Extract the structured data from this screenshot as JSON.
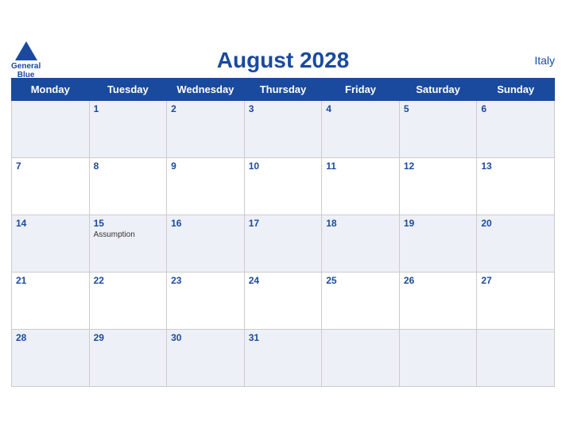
{
  "header": {
    "title": "August 2028",
    "country": "Italy",
    "logo_general": "General",
    "logo_blue": "Blue"
  },
  "weekdays": [
    "Monday",
    "Tuesday",
    "Wednesday",
    "Thursday",
    "Friday",
    "Saturday",
    "Sunday"
  ],
  "weeks": [
    [
      {
        "day": "",
        "empty": true
      },
      {
        "day": "1"
      },
      {
        "day": "2"
      },
      {
        "day": "3"
      },
      {
        "day": "4"
      },
      {
        "day": "5"
      },
      {
        "day": "6"
      }
    ],
    [
      {
        "day": "7"
      },
      {
        "day": "8"
      },
      {
        "day": "9"
      },
      {
        "day": "10"
      },
      {
        "day": "11"
      },
      {
        "day": "12"
      },
      {
        "day": "13"
      }
    ],
    [
      {
        "day": "14"
      },
      {
        "day": "15",
        "event": "Assumption"
      },
      {
        "day": "16"
      },
      {
        "day": "17"
      },
      {
        "day": "18"
      },
      {
        "day": "19"
      },
      {
        "day": "20"
      }
    ],
    [
      {
        "day": "21"
      },
      {
        "day": "22"
      },
      {
        "day": "23"
      },
      {
        "day": "24"
      },
      {
        "day": "25"
      },
      {
        "day": "26"
      },
      {
        "day": "27"
      }
    ],
    [
      {
        "day": "28"
      },
      {
        "day": "29"
      },
      {
        "day": "30"
      },
      {
        "day": "31"
      },
      {
        "day": ""
      },
      {
        "day": ""
      },
      {
        "day": ""
      }
    ]
  ]
}
